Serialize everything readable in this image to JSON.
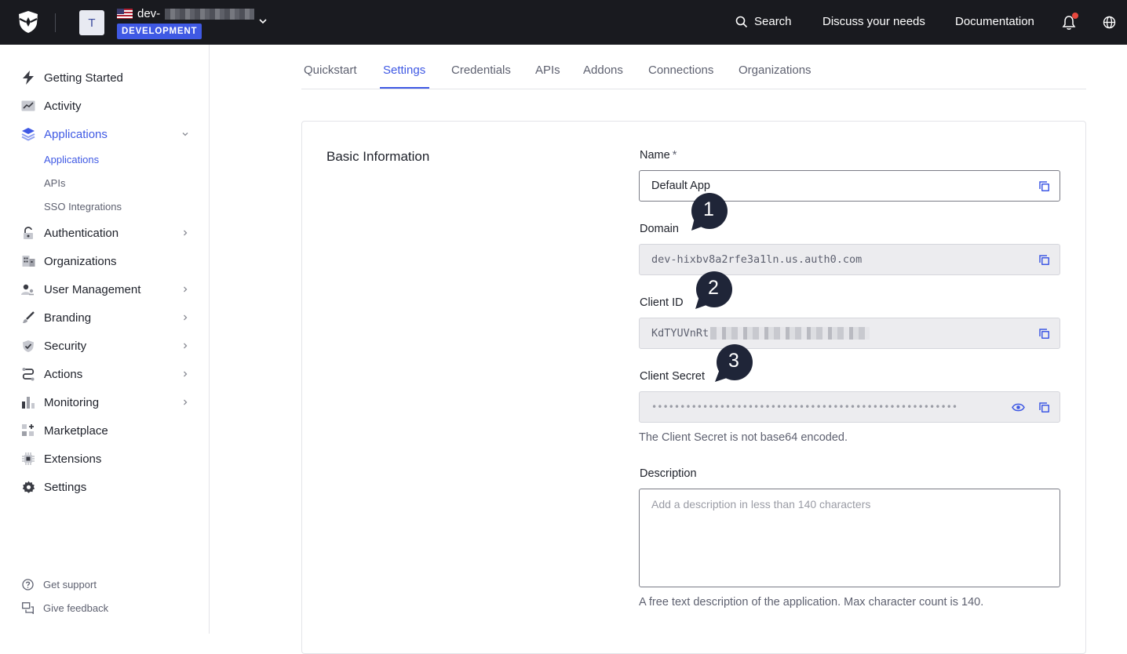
{
  "header": {
    "tenant_initial": "T",
    "tenant_name": "dev-",
    "environment_badge": "DEVELOPMENT",
    "search_label": "Search",
    "discuss_label": "Discuss your needs",
    "docs_label": "Documentation",
    "notification_dot_color": "#e8483e"
  },
  "sidebar": {
    "items": [
      {
        "label": "Getting Started",
        "icon": "lightning-icon"
      },
      {
        "label": "Activity",
        "icon": "activity-chart-icon"
      },
      {
        "label": "Applications",
        "icon": "layers-icon"
      },
      {
        "label": "Authentication",
        "icon": "lock-icon"
      },
      {
        "label": "Organizations",
        "icon": "building-icon"
      },
      {
        "label": "User Management",
        "icon": "users-icon"
      },
      {
        "label": "Branding",
        "icon": "brush-icon"
      },
      {
        "label": "Security",
        "icon": "shield-check-icon"
      },
      {
        "label": "Actions",
        "icon": "flow-icon"
      },
      {
        "label": "Monitoring",
        "icon": "bar-chart-icon"
      },
      {
        "label": "Marketplace",
        "icon": "grid-plus-icon"
      },
      {
        "label": "Extensions",
        "icon": "chip-icon"
      },
      {
        "label": "Settings",
        "icon": "gear-icon"
      }
    ],
    "sub_items": [
      "Applications",
      "APIs",
      "SSO Integrations"
    ],
    "footer": {
      "support": "Get support",
      "feedback": "Give feedback"
    }
  },
  "tabs": [
    "Quickstart",
    "Settings",
    "Credentials",
    "APIs",
    "Addons",
    "Connections",
    "Organizations"
  ],
  "active_tab": "Settings",
  "form": {
    "section_title": "Basic Information",
    "name_label": "Name",
    "name_required_marker": "*",
    "name_value": "Default App",
    "domain_label": "Domain",
    "domain_value": "dev-hixbv8a2rfe3a1ln.us.auth0.com",
    "client_id_label": "Client ID",
    "client_id_value": "KdTYUVnRt",
    "client_secret_label": "Client Secret",
    "client_secret_value": "••••••••••••••••••••••••••••••••••••••••••••••••••••••",
    "client_secret_help": "The Client Secret is not base64 encoded.",
    "description_label": "Description",
    "description_placeholder": "Add a description in less than 140 characters",
    "description_help": "A free text description of the application. Max character count is 140."
  },
  "annotations": [
    "1",
    "2",
    "3"
  ],
  "colors": {
    "accent": "#3f59e4",
    "topbar": "#191a1f",
    "bubble": "#1f2538"
  }
}
